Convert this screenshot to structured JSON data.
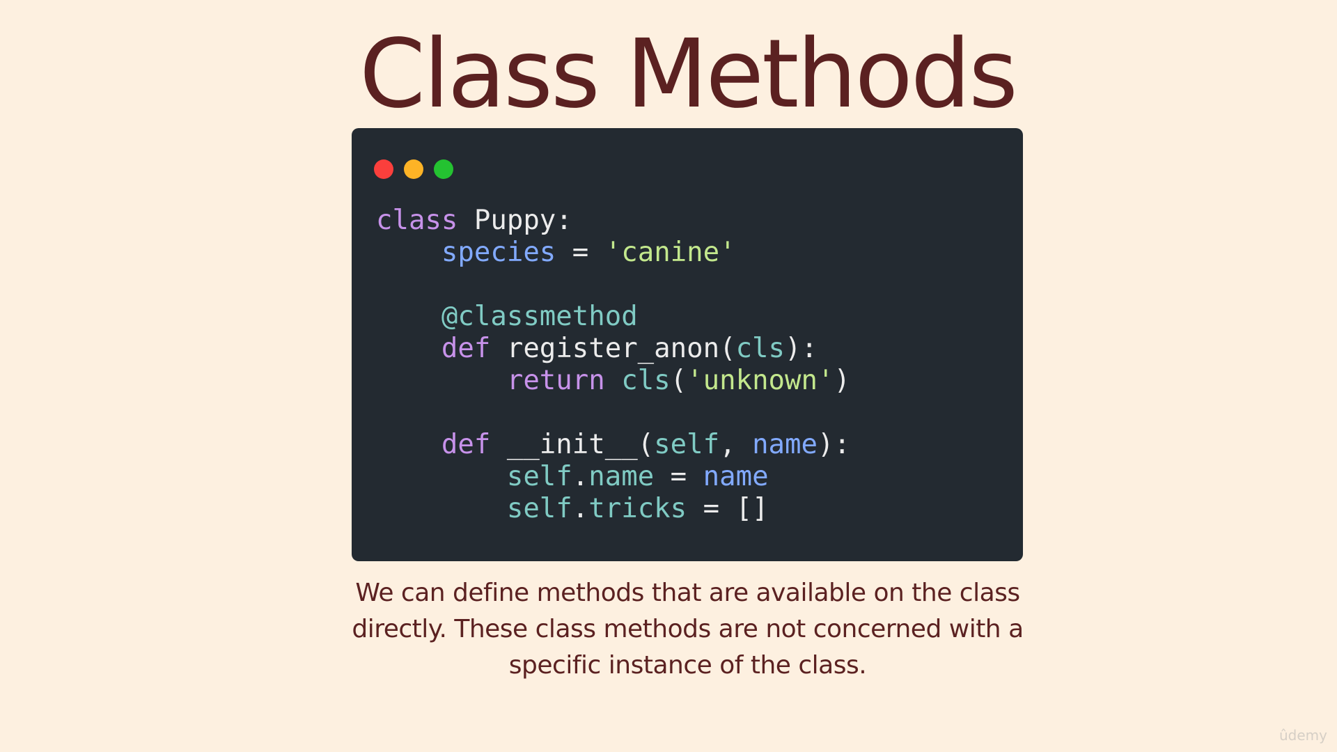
{
  "slide": {
    "title": "Class Methods"
  },
  "window_controls": {
    "colors": [
      "#fb3f3c",
      "#fdb326",
      "#24c231"
    ]
  },
  "code": {
    "lines": [
      [
        {
          "t": "class ",
          "c": "kw"
        },
        {
          "t": "Puppy:",
          "c": "plain"
        }
      ],
      [
        {
          "t": "    ",
          "c": "plain"
        },
        {
          "t": "species",
          "c": "var"
        },
        {
          "t": " = ",
          "c": "plain"
        },
        {
          "t": "'canine'",
          "c": "str"
        }
      ],
      [],
      [
        {
          "t": "    ",
          "c": "plain"
        },
        {
          "t": "@classmethod",
          "c": "dec"
        }
      ],
      [
        {
          "t": "    ",
          "c": "plain"
        },
        {
          "t": "def ",
          "c": "kw"
        },
        {
          "t": "register_anon(",
          "c": "plain"
        },
        {
          "t": "cls",
          "c": "cls"
        },
        {
          "t": "):",
          "c": "plain"
        }
      ],
      [
        {
          "t": "        ",
          "c": "plain"
        },
        {
          "t": "return ",
          "c": "kw"
        },
        {
          "t": "cls",
          "c": "cls"
        },
        {
          "t": "(",
          "c": "plain"
        },
        {
          "t": "'unknown'",
          "c": "str"
        },
        {
          "t": ")",
          "c": "plain"
        }
      ],
      [],
      [
        {
          "t": "    ",
          "c": "plain"
        },
        {
          "t": "def ",
          "c": "kw"
        },
        {
          "t": "__init__(",
          "c": "plain"
        },
        {
          "t": "self",
          "c": "cls"
        },
        {
          "t": ", ",
          "c": "plain"
        },
        {
          "t": "name",
          "c": "var"
        },
        {
          "t": "):",
          "c": "plain"
        }
      ],
      [
        {
          "t": "        ",
          "c": "plain"
        },
        {
          "t": "self",
          "c": "cls"
        },
        {
          "t": ".",
          "c": "plain"
        },
        {
          "t": "name",
          "c": "cls"
        },
        {
          "t": " = ",
          "c": "plain"
        },
        {
          "t": "name",
          "c": "var"
        }
      ],
      [
        {
          "t": "        ",
          "c": "plain"
        },
        {
          "t": "self",
          "c": "cls"
        },
        {
          "t": ".",
          "c": "plain"
        },
        {
          "t": "tricks",
          "c": "cls"
        },
        {
          "t": " = []",
          "c": "plain"
        }
      ]
    ]
  },
  "caption": {
    "lines": [
      "We can define methods that are available on the class",
      "directly.  These class methods are not concerned with a",
      "specific instance of the class."
    ]
  },
  "watermark": {
    "text": "ûdemy"
  }
}
